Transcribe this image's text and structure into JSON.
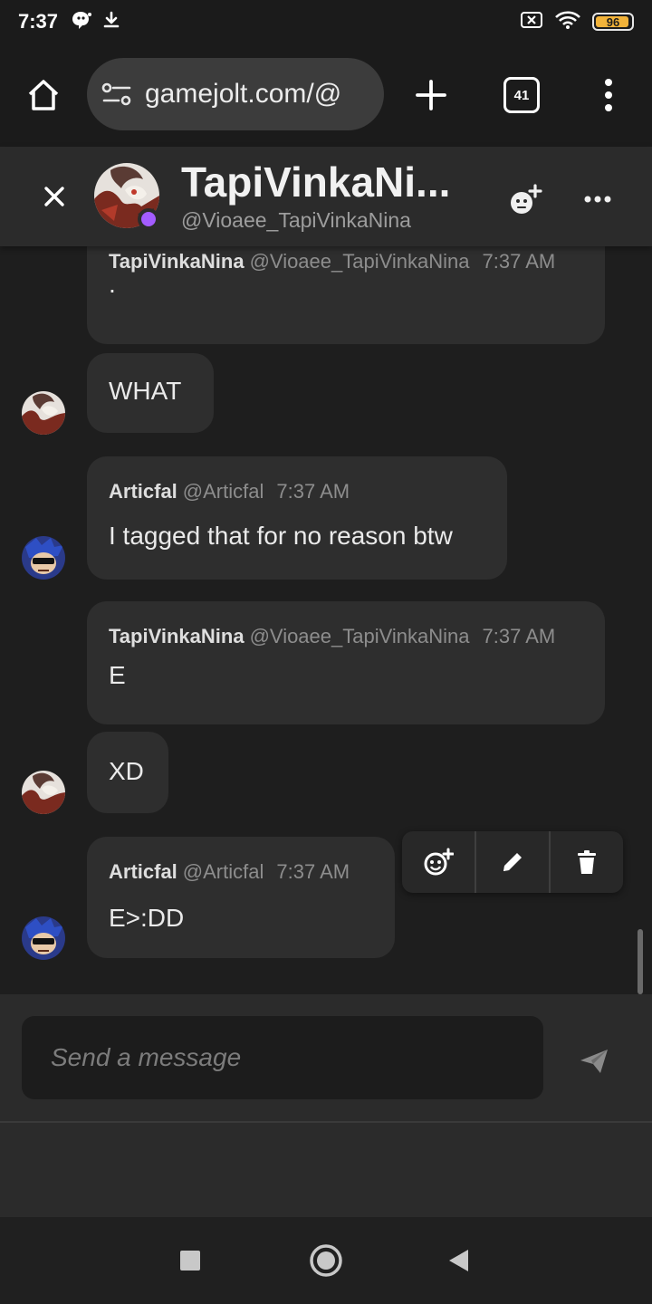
{
  "status_bar": {
    "time": "7:37",
    "battery": "96",
    "battery_level": 0.96
  },
  "browser": {
    "url": "gamejolt.com/@",
    "tab_count": "41"
  },
  "chat_header": {
    "name": "TapiVinkaNi...",
    "handle": "@Vioaee_TapiVinkaNina"
  },
  "messages": [
    {
      "name": "TapiVinkaNina",
      "handle": "@Vioaee_TapiVinkaNina",
      "time": "7:37 AM",
      "text": "."
    },
    {
      "text": "WHAT"
    },
    {
      "name": "Articfal",
      "handle": "@Articfal",
      "time": "7:37 AM",
      "text": "I tagged that for no reason btw"
    },
    {
      "name": "TapiVinkaNina",
      "handle": "@Vioaee_TapiVinkaNina",
      "time": "7:37 AM",
      "text": "E"
    },
    {
      "text": "XD"
    },
    {
      "name": "Articfal",
      "handle": "@Articfal",
      "time": "7:37 AM",
      "text": "E>:DD"
    }
  ],
  "composer": {
    "placeholder": "Send a message"
  },
  "colors": {
    "online": "#a35cff",
    "bubble": "#2e2e2e",
    "header": "#2b2b2b"
  },
  "icons": [
    "home-icon",
    "site-settings-icon",
    "plus-icon",
    "tabs-icon",
    "kebab-menu-icon",
    "close-icon",
    "add-friend-icon",
    "more-icon",
    "add-reaction-icon",
    "edit-icon",
    "delete-icon",
    "send-icon",
    "recents-icon",
    "home-nav-icon",
    "back-icon"
  ]
}
